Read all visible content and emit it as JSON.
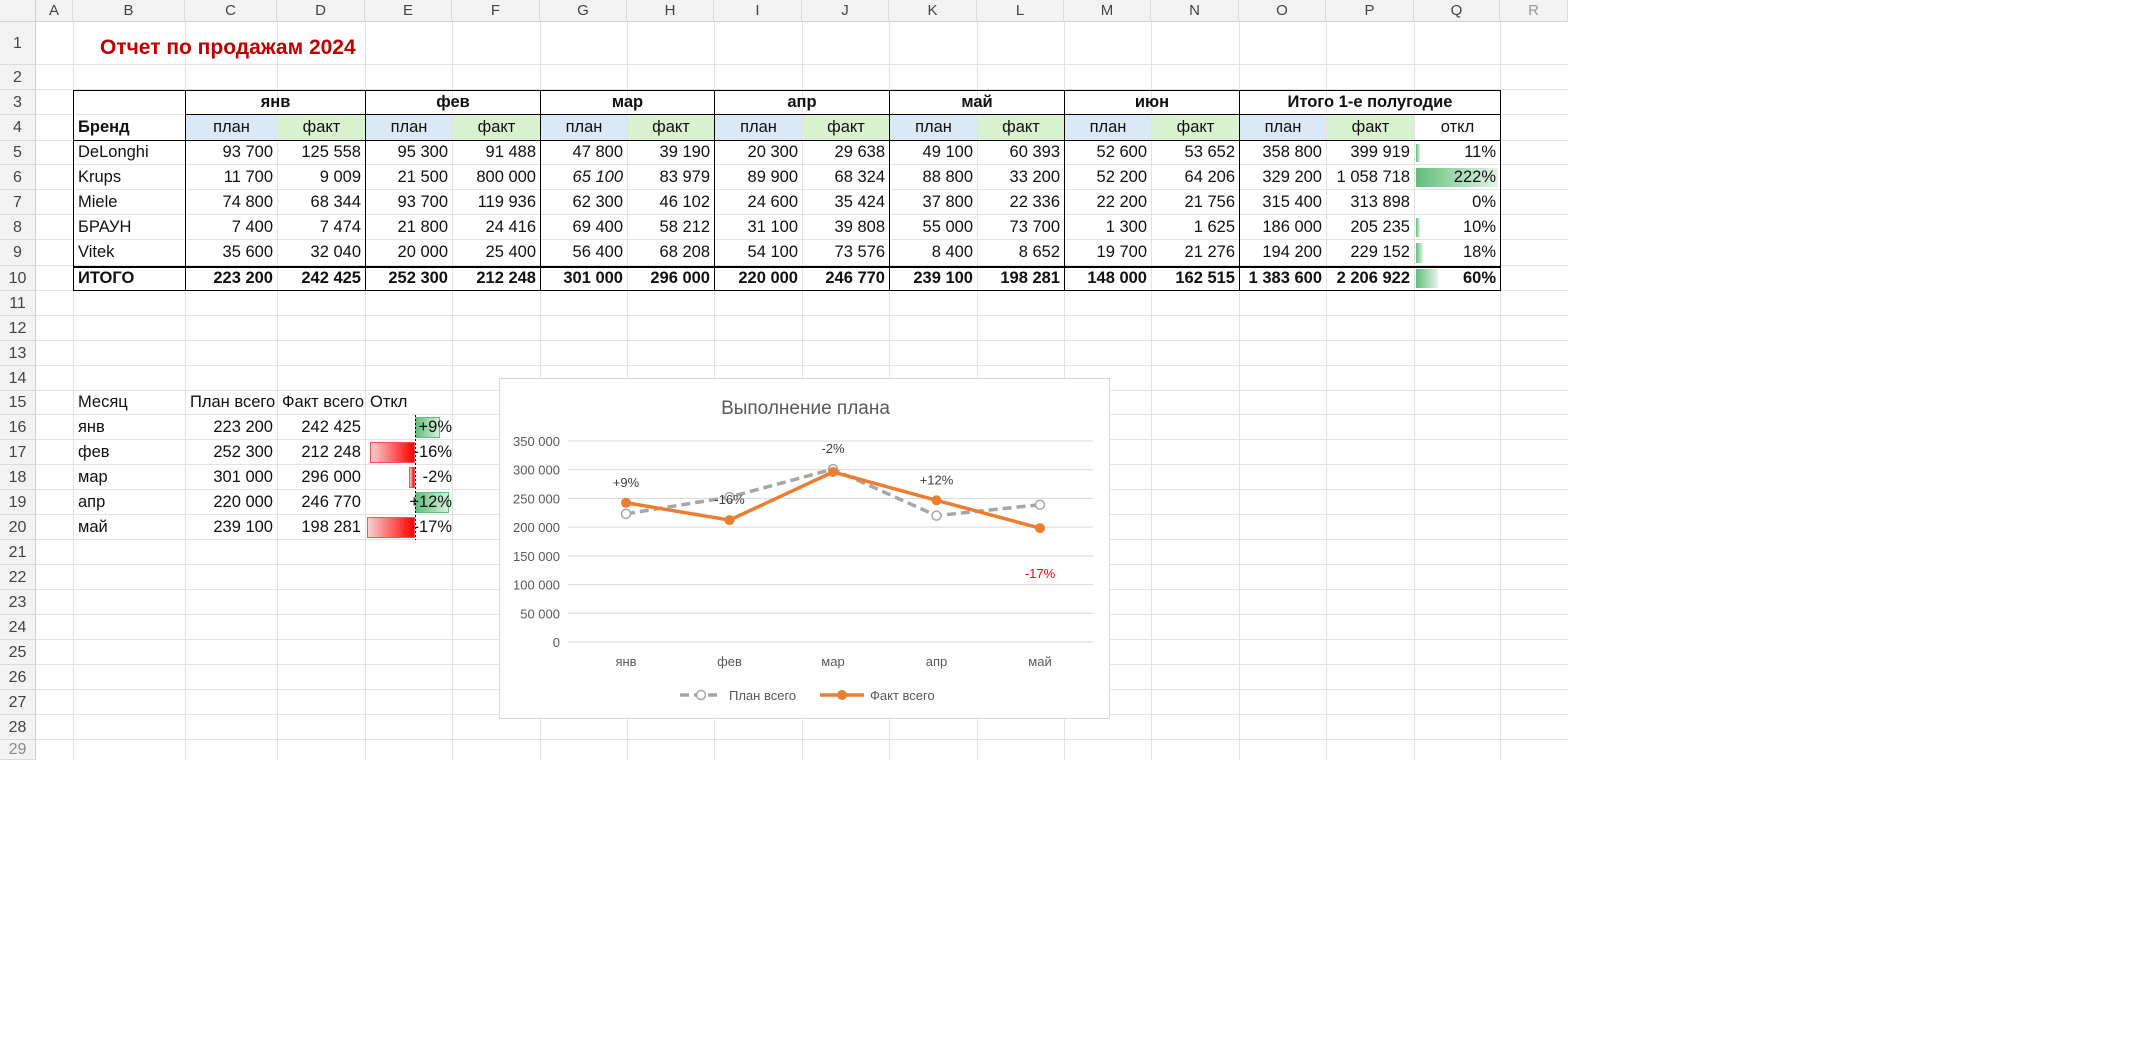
{
  "columns": [
    "A",
    "B",
    "C",
    "D",
    "E",
    "F",
    "G",
    "H",
    "I",
    "J",
    "K",
    "L",
    "M",
    "N",
    "O",
    "P",
    "Q",
    "R"
  ],
  "rows": [
    "1",
    "2",
    "3",
    "4",
    "5",
    "6",
    "7",
    "8",
    "9",
    "10",
    "11",
    "12",
    "13",
    "14",
    "15",
    "16",
    "17",
    "18",
    "19",
    "20",
    "21",
    "22",
    "23",
    "24",
    "25",
    "26",
    "27",
    "28",
    "29"
  ],
  "title": "Отчет по продажам 2024",
  "table": {
    "brand_header": "Бренд",
    "months": [
      "янв",
      "фев",
      "мар",
      "апр",
      "май",
      "июн"
    ],
    "total_header": "Итого 1-е полугодие",
    "plan_label": "план",
    "fact_label": "факт",
    "dev_label": "откл",
    "rows": [
      {
        "brand": "DeLonghi",
        "values": [
          "93 700",
          "125 558",
          "95 300",
          "91 488",
          "47 800",
          "39 190",
          "20 300",
          "29 638",
          "49 100",
          "60 393",
          "52 600",
          "53 652"
        ],
        "total_plan": "358 800",
        "total_fact": "399 919",
        "dev": "11%",
        "dev_fraction": 0.11
      },
      {
        "brand": "Krups",
        "values": [
          "11 700",
          "9 009",
          "21 500",
          "800 000",
          "65 100",
          "83 979",
          "89 900",
          "68 324",
          "88 800",
          "33 200",
          "52 200",
          "64 206"
        ],
        "total_plan": "329 200",
        "total_fact": "1 058 718",
        "dev": "222%",
        "dev_fraction": 2.22
      },
      {
        "brand": "Miele",
        "values": [
          "74 800",
          "68 344",
          "93 700",
          "119 936",
          "62 300",
          "46 102",
          "24 600",
          "35 424",
          "37 800",
          "22 336",
          "22 200",
          "21 756"
        ],
        "total_plan": "315 400",
        "total_fact": "313 898",
        "dev": "0%",
        "dev_fraction": 0.0
      },
      {
        "brand": "БРАУН",
        "values": [
          "7 400",
          "7 474",
          "21 800",
          "24 416",
          "69 400",
          "58 212",
          "31 100",
          "39 808",
          "55 000",
          "73 700",
          "1 300",
          "1 625"
        ],
        "total_plan": "186 000",
        "total_fact": "205 235",
        "dev": "10%",
        "dev_fraction": 0.1
      },
      {
        "brand": "Vitek",
        "values": [
          "35 600",
          "32 040",
          "20 000",
          "25 400",
          "56 400",
          "68 208",
          "54 100",
          "73 576",
          "8 400",
          "8 652",
          "19 700",
          "21 276"
        ],
        "total_plan": "194 200",
        "total_fact": "229 152",
        "dev": "18%",
        "dev_fraction": 0.18
      }
    ],
    "total": {
      "label": "ИТОГО",
      "values": [
        "223 200",
        "242 425",
        "252 300",
        "212 248",
        "301 000",
        "296 000",
        "220 000",
        "246 770",
        "239 100",
        "198 281",
        "148 000",
        "162 515"
      ],
      "total_plan": "1 383 600",
      "total_fact": "2 206 922",
      "dev": "60%",
      "dev_fraction": 0.6
    }
  },
  "summary": {
    "headers": [
      "Месяц",
      "План всего",
      "Факт всего",
      "Откл"
    ],
    "rows": [
      {
        "month": "янв",
        "plan": "223 200",
        "fact": "242 425",
        "dev": "+9%",
        "dev_value": 0.09
      },
      {
        "month": "фев",
        "plan": "252 300",
        "fact": "212 248",
        "dev": "-16%",
        "dev_value": -0.16
      },
      {
        "month": "мар",
        "plan": "301 000",
        "fact": "296 000",
        "dev": "-2%",
        "dev_value": -0.02
      },
      {
        "month": "апр",
        "plan": "220 000",
        "fact": "246 770",
        "dev": "+12%",
        "dev_value": 0.12
      },
      {
        "month": "май",
        "plan": "239 100",
        "fact": "198 281",
        "dev": "-17%",
        "dev_value": -0.17
      }
    ]
  },
  "chart_data": {
    "type": "line",
    "title": "Выполнение плана",
    "categories": [
      "янв",
      "фев",
      "мар",
      "апр",
      "май"
    ],
    "series": [
      {
        "name": "План всего",
        "values": [
          223200,
          252300,
          301000,
          220000,
          239100
        ],
        "color": "#a6a6a6",
        "style": "dashed"
      },
      {
        "name": "Факт всего",
        "values": [
          242425,
          212248,
          296000,
          246770,
          198281
        ],
        "color": "#ed7d31",
        "style": "solid"
      }
    ],
    "data_labels": [
      "+9%",
      "-16%",
      "-2%",
      "+12%",
      "-17%"
    ],
    "negative_label_color": "#ff0000",
    "yticks": [
      "0",
      "50 000",
      "100 000",
      "150 000",
      "200 000",
      "250 000",
      "300 000",
      "350 000"
    ],
    "ylim": [
      0,
      350000
    ],
    "grid": true,
    "legend": "bottom"
  },
  "colors": {
    "title": "#c00000",
    "plan_fill": "#dbe9f7",
    "fact_fill": "#d9f2d0",
    "positive_bar": "#63be7b",
    "negative_bar": "#ff0000"
  }
}
